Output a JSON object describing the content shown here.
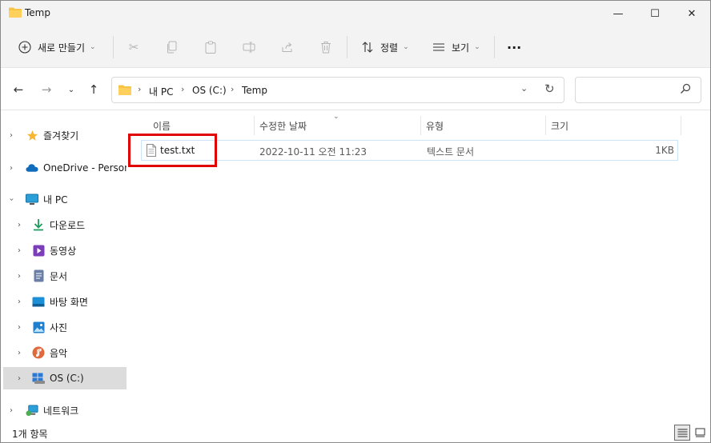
{
  "window": {
    "title": "Temp"
  },
  "titlebar": {
    "minimize": "—",
    "maximize": "☐",
    "close": "✕"
  },
  "toolbar": {
    "new_label": "새로 만들기",
    "sort_label": "정렬",
    "view_label": "보기",
    "more_label": "···"
  },
  "address": {
    "crumbs": [
      "내 PC",
      "OS (C:)",
      "Temp"
    ],
    "search_placeholder": ""
  },
  "sidebar": {
    "items": [
      {
        "label": "즐겨찾기",
        "icon": "star-icon"
      },
      {
        "label": "OneDrive - Personal",
        "icon": "cloud-icon"
      },
      {
        "label": "내 PC",
        "icon": "monitor-icon"
      },
      {
        "label": "다운로드",
        "icon": "download-icon"
      },
      {
        "label": "동영상",
        "icon": "video-icon"
      },
      {
        "label": "문서",
        "icon": "document-icon"
      },
      {
        "label": "바탕 화면",
        "icon": "desktop-icon"
      },
      {
        "label": "사진",
        "icon": "picture-icon"
      },
      {
        "label": "음악",
        "icon": "music-icon"
      },
      {
        "label": "OS (C:)",
        "icon": "drive-icon",
        "selected": true
      },
      {
        "label": "네트워크",
        "icon": "network-icon"
      }
    ]
  },
  "columns": {
    "name": "이름",
    "modified": "수정한 날짜",
    "type": "유형",
    "size": "크기"
  },
  "files": [
    {
      "name": "test.txt",
      "modified": "2022-10-11 오전 11:23",
      "type": "텍스트 문서",
      "size": "1KB"
    }
  ],
  "status": {
    "count": "1개 항목"
  },
  "colors": {
    "accent": "#0067c0",
    "highlight_box": "#e00000",
    "folder": "#f6c344"
  }
}
